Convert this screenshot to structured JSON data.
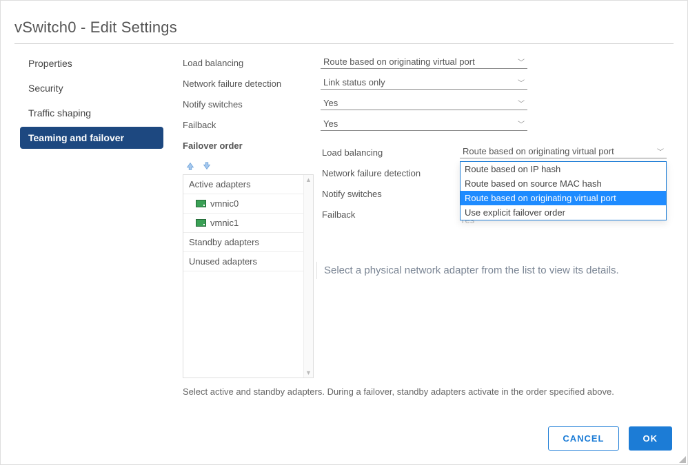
{
  "title": "vSwitch0 - Edit Settings",
  "sidenav": {
    "items": [
      "Properties",
      "Security",
      "Traffic shaping",
      "Teaming and failover"
    ],
    "activeIndex": 3
  },
  "form": {
    "loadBalancing": {
      "label": "Load balancing",
      "value": "Route based on originating virtual port"
    },
    "failureDetection": {
      "label": "Network failure detection",
      "value": "Link status only"
    },
    "notifySwitches": {
      "label": "Notify switches",
      "value": "Yes"
    },
    "failback": {
      "label": "Failback",
      "value": "Yes"
    },
    "failoverOrderLabel": "Failover order"
  },
  "adapters": {
    "activeLabel": "Active adapters",
    "items": [
      "vmnic0",
      "vmnic1"
    ],
    "standbyLabel": "Standby adapters",
    "unusedLabel": "Unused adapters"
  },
  "nested": {
    "loadBalancing": {
      "label": "Load balancing",
      "value": "Route based on originating virtual port"
    },
    "failureDetection": {
      "label": "Network failure detection"
    },
    "notifySwitches": {
      "label": "Notify switches"
    },
    "failback": {
      "label": "Failback"
    },
    "ghostValue": "Yes",
    "options": [
      "Route based on IP hash",
      "Route based on source MAC hash",
      "Route based on originating virtual port",
      "Use explicit failover order"
    ],
    "selectedOptionIndex": 2,
    "helpText": "Select a physical network adapter from the list to view its details."
  },
  "hint": "Select active and standby adapters. During a failover, standby adapters activate in the order specified above.",
  "footer": {
    "cancel": "CANCEL",
    "ok": "OK"
  }
}
